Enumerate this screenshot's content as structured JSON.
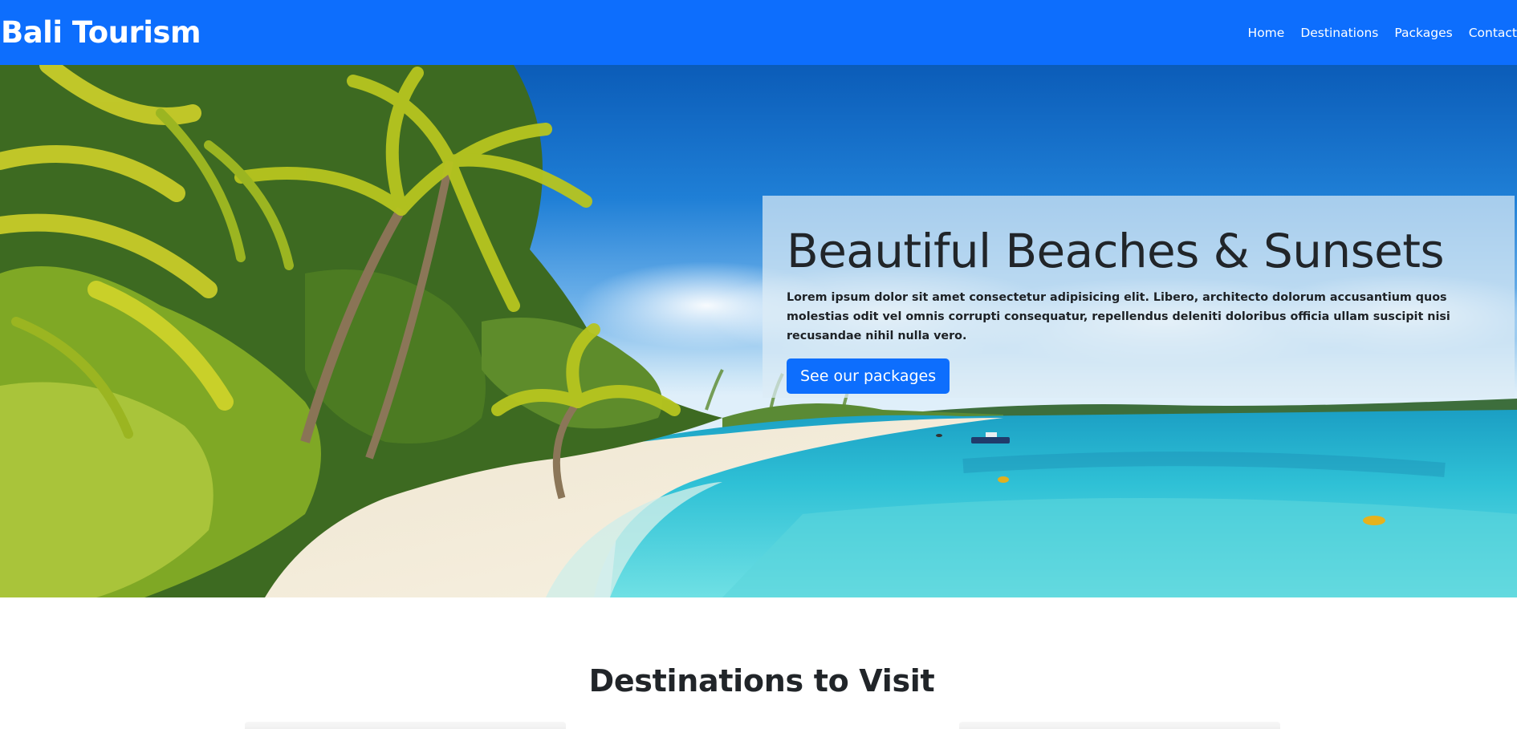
{
  "nav": {
    "brand": "Bali Tourism",
    "links": [
      "Home",
      "Destinations",
      "Packages",
      "Contact"
    ]
  },
  "hero": {
    "title": "Beautiful Beaches & Sunsets",
    "text": "Lorem ipsum dolor sit amet consectetur adipisicing elit. Libero, architecto dolorum accusantium quos molestias odit vel omnis corrupti consequatur, repellendus deleniti doloribus officia ullam suscipit nisi recusandae nihil nulla vero.",
    "button_label": "See our packages"
  },
  "destinations": {
    "title": "Destinations to Visit"
  },
  "colors": {
    "primary": "#0d6efd",
    "text": "#212529",
    "white": "#ffffff"
  }
}
